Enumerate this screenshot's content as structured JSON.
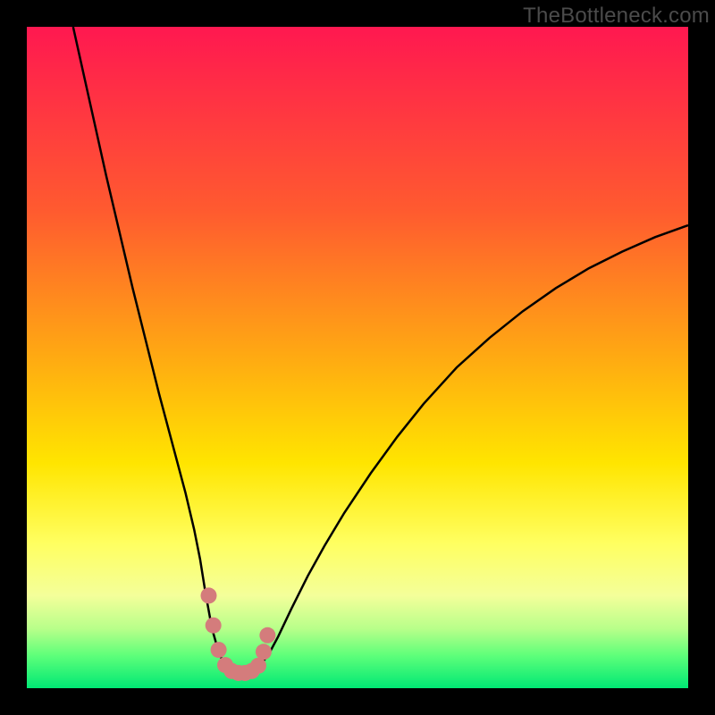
{
  "watermark": "TheBottleneck.com",
  "chart_data": {
    "type": "line",
    "title": "",
    "xlabel": "",
    "ylabel": "",
    "xlim": [
      0,
      100
    ],
    "ylim": [
      0,
      100
    ],
    "grid": false,
    "legend": false,
    "background_gradient": {
      "stops": [
        {
          "offset": 0.0,
          "color": "#ff1850"
        },
        {
          "offset": 0.28,
          "color": "#ff5b2f"
        },
        {
          "offset": 0.5,
          "color": "#ffaa12"
        },
        {
          "offset": 0.66,
          "color": "#ffe500"
        },
        {
          "offset": 0.78,
          "color": "#ffff60"
        },
        {
          "offset": 0.86,
          "color": "#f4ff9a"
        },
        {
          "offset": 0.91,
          "color": "#b8ff8a"
        },
        {
          "offset": 0.95,
          "color": "#5fff7a"
        },
        {
          "offset": 1.0,
          "color": "#00e874"
        }
      ]
    },
    "series": [
      {
        "name": "bottleneck-curve",
        "color": "#000000",
        "stroke_width": 2.5,
        "x": [
          7.0,
          8.0,
          9.0,
          10.0,
          12.0,
          14.0,
          16.0,
          18.0,
          20.0,
          22.0,
          24.0,
          25.3,
          26.2,
          27.0,
          28.0,
          29.0,
          30.0,
          31.0,
          32.0,
          33.0,
          34.0,
          35.0,
          36.5,
          38.0,
          40.0,
          42.5,
          45.0,
          48.0,
          52.0,
          56.0,
          60.0,
          65.0,
          70.0,
          75.0,
          80.0,
          85.0,
          90.0,
          95.0,
          100.0
        ],
        "y": [
          100.0,
          95.5,
          91.0,
          86.5,
          77.5,
          69.0,
          60.5,
          52.5,
          44.5,
          37.0,
          29.5,
          24.0,
          19.5,
          14.5,
          9.0,
          5.5,
          3.2,
          2.5,
          2.2,
          2.2,
          2.5,
          3.2,
          5.0,
          7.8,
          12.0,
          17.0,
          21.5,
          26.5,
          32.5,
          38.0,
          43.0,
          48.5,
          53.0,
          57.0,
          60.5,
          63.5,
          66.0,
          68.2,
          70.0
        ]
      },
      {
        "name": "marker-band",
        "type": "scatter",
        "color": "#d47c7c",
        "marker_radius": 9,
        "x": [
          27.5,
          28.2,
          29.0,
          30.0,
          31.0,
          32.0,
          33.0,
          34.0,
          35.0,
          35.8,
          36.4
        ],
        "y": [
          14.0,
          9.5,
          5.8,
          3.5,
          2.6,
          2.3,
          2.3,
          2.6,
          3.4,
          5.5,
          8.0
        ]
      }
    ]
  }
}
